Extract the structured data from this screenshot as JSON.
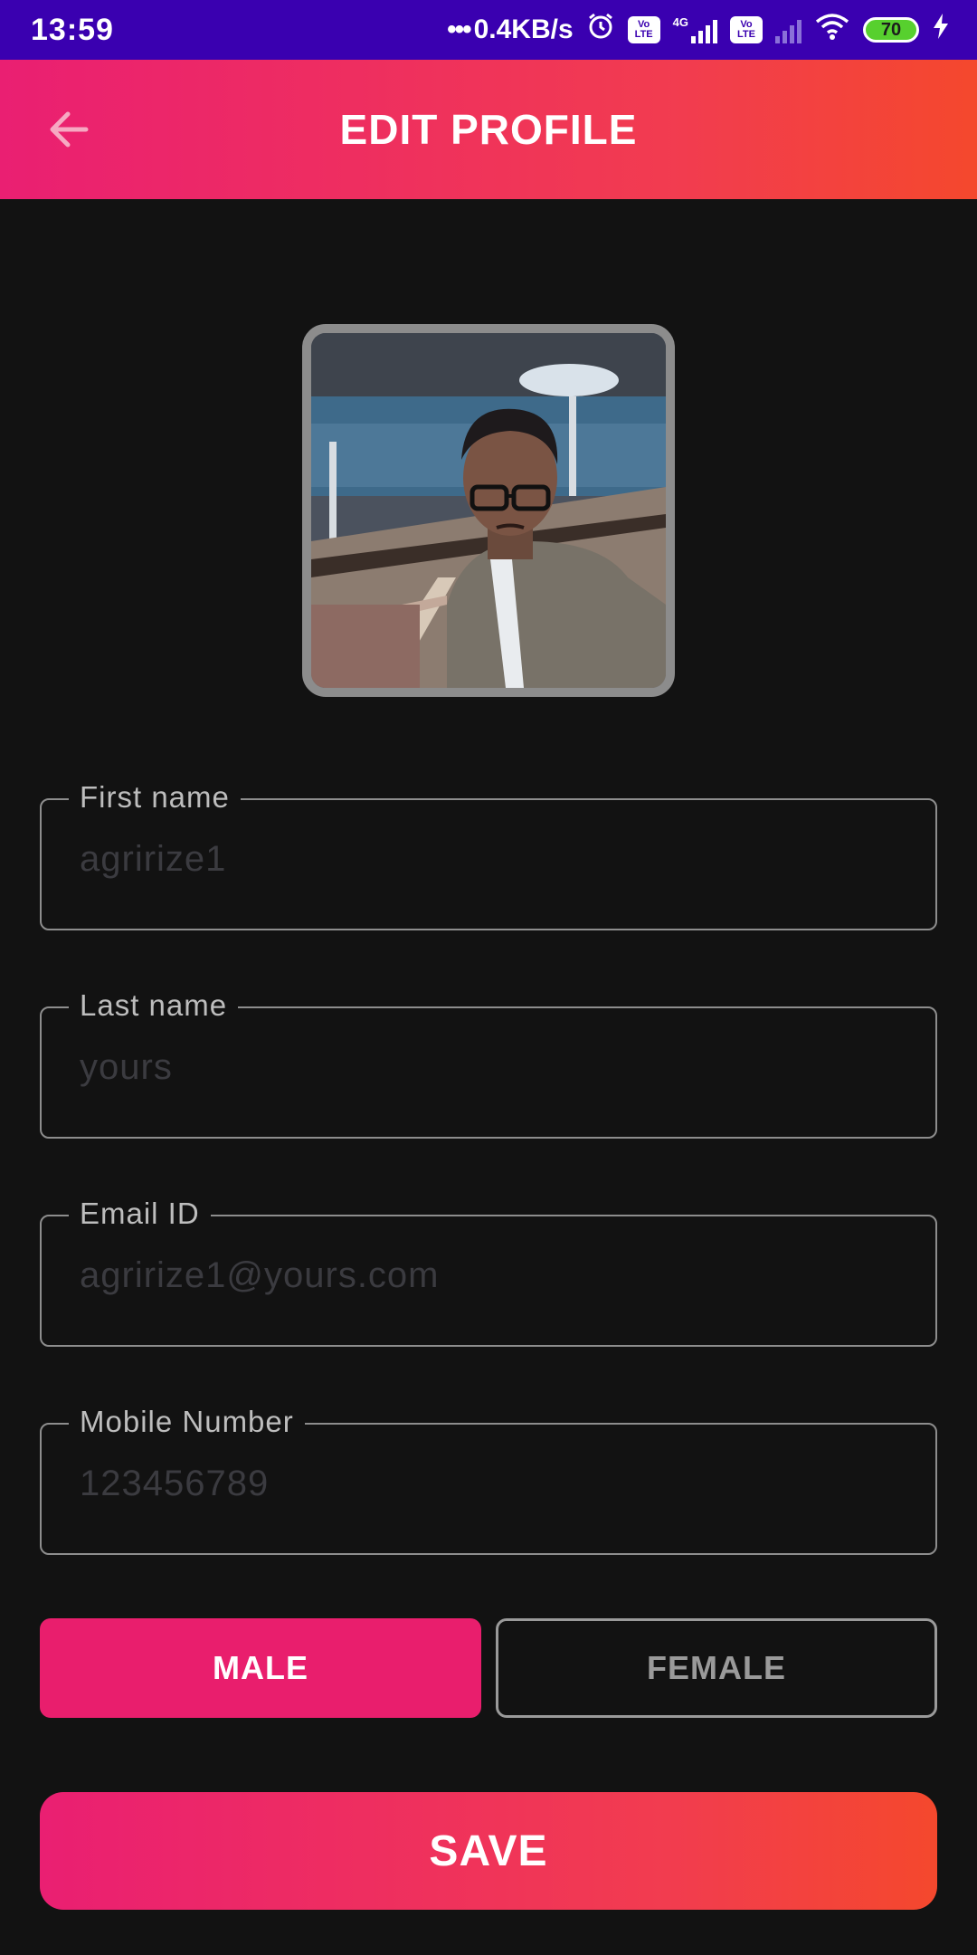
{
  "status_bar": {
    "time": "13:59",
    "net_speed": "0.4KB/s",
    "net_dots": "•••",
    "volte1": "Vo LTE",
    "volte2": "Vo LTE",
    "net_type": "4G",
    "battery": "70"
  },
  "header": {
    "title": "EDIT PROFILE"
  },
  "form": {
    "first_name": {
      "label": "First name",
      "placeholder": "agririze1"
    },
    "last_name": {
      "label": "Last name",
      "placeholder": "yours"
    },
    "email": {
      "label": "Email ID",
      "placeholder": "agririze1@yours.com"
    },
    "mobile": {
      "label": "Mobile Number",
      "placeholder": "123456789"
    }
  },
  "gender": {
    "male_label": "MALE",
    "female_label": "FEMALE",
    "selected": "MALE"
  },
  "save_label": "SAVE",
  "colors": {
    "accent": "#e91e6d",
    "gradient_end": "#f4482d",
    "status_bar": "#3a00b0",
    "background": "#121212"
  }
}
